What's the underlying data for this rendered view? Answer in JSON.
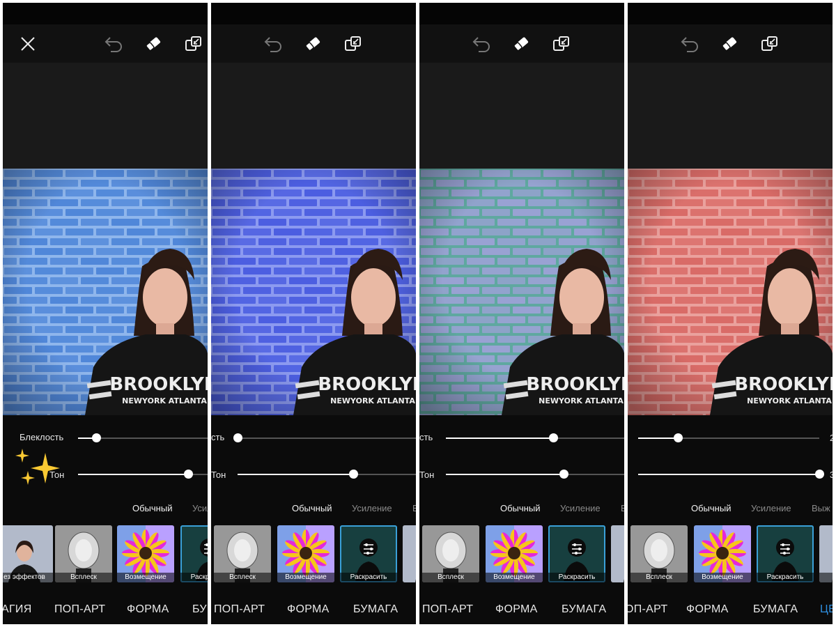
{
  "panels": [
    {
      "brick_color": "#4f86d8",
      "mortar_color": "#8fb6ec",
      "show_close": true,
      "labels": {
        "fade": "Блеклость",
        "tone": "Тон"
      },
      "fade_value": 0.14,
      "tone_value": 0.85,
      "modes": {
        "normal": "Обычный",
        "boost": "Усиле"
      },
      "thumbs": [
        {
          "caption": "ез эффектов",
          "kind": "girl",
          "selected": false
        },
        {
          "caption": "Всплеск",
          "kind": "hat",
          "selected": false
        },
        {
          "caption": "Возмещение",
          "kind": "flower",
          "selected": false
        },
        {
          "caption": "Раскрасить",
          "kind": "color",
          "selected": true
        }
      ],
      "categories": [
        "АГИЯ",
        "ПОП-АРТ",
        "ФОРМА",
        "БУ"
      ],
      "active_category": -1,
      "sparkle": true
    },
    {
      "brick_color": "#4a5de0",
      "mortar_color": "#8c9af0",
      "show_close": false,
      "labels": {
        "fade": "сть",
        "tone": "Тон"
      },
      "fade_value": 0.0,
      "tone_value": 0.65,
      "modes": {
        "normal": "Обычный",
        "boost": "Усиление",
        "extra": "В"
      },
      "thumbs": [
        {
          "caption": "Всплеск",
          "kind": "hat",
          "selected": false
        },
        {
          "caption": "Возмещение",
          "kind": "flower",
          "selected": false
        },
        {
          "caption": "Раскрасить",
          "kind": "color",
          "selected": true
        },
        {
          "caption": "",
          "kind": "girl",
          "selected": false
        }
      ],
      "categories": [
        "ПОП-АРТ",
        "ФОРМА",
        "БУМАГА"
      ],
      "active_category": -1,
      "sparkle": false
    },
    {
      "brick_color": "#9aa2d4",
      "mortar_color": "#5fa8a0",
      "show_close": false,
      "labels": {
        "fade": "сть",
        "tone": "Тон"
      },
      "fade_value": 0.6,
      "tone_value": 0.66,
      "modes": {
        "normal": "Обычный",
        "boost": "Усиление",
        "extra": "В"
      },
      "thumbs": [
        {
          "caption": "Всплеск",
          "kind": "hat",
          "selected": false
        },
        {
          "caption": "Возмещение",
          "kind": "flower",
          "selected": false
        },
        {
          "caption": "Раскрасить",
          "kind": "color",
          "selected": true
        },
        {
          "caption": "",
          "kind": "girl",
          "selected": false
        }
      ],
      "categories": [
        "ПОП-АРТ",
        "ФОРМА",
        "БУМАГА"
      ],
      "active_category": -1,
      "sparkle": false
    },
    {
      "brick_color": "#d86a66",
      "mortar_color": "#eaa19d",
      "show_close": false,
      "labels": {
        "fade": "",
        "tone": "",
        "fade_value_text": "2",
        "tone_value_text": "3"
      },
      "fade_value": 0.22,
      "tone_value": 1.0,
      "modes": {
        "normal": "Обычный",
        "boost": "Усиление",
        "extra": "Выж"
      },
      "thumbs": [
        {
          "caption": "Всплеск",
          "kind": "hat",
          "selected": false
        },
        {
          "caption": "Возмещение",
          "kind": "flower",
          "selected": false
        },
        {
          "caption": "Раскрасить",
          "kind": "color",
          "selected": true
        },
        {
          "caption": "То",
          "kind": "girl",
          "selected": false
        }
      ],
      "categories": [
        "ОП-АРТ",
        "ФОРМА",
        "БУМАГА",
        "ЦЕ"
      ],
      "active_category": 3,
      "sparkle": false
    }
  ],
  "accent_color": "#2e8fe0",
  "shirt_text": {
    "line1": "BROOKLYN",
    "line2": "NEWYORK ATLANTA"
  },
  "icons": {
    "close": "close-icon",
    "undo": "undo-icon",
    "eraser": "eraser-icon",
    "compare": "compare-icon",
    "sparkle": "sparkle-icon"
  }
}
